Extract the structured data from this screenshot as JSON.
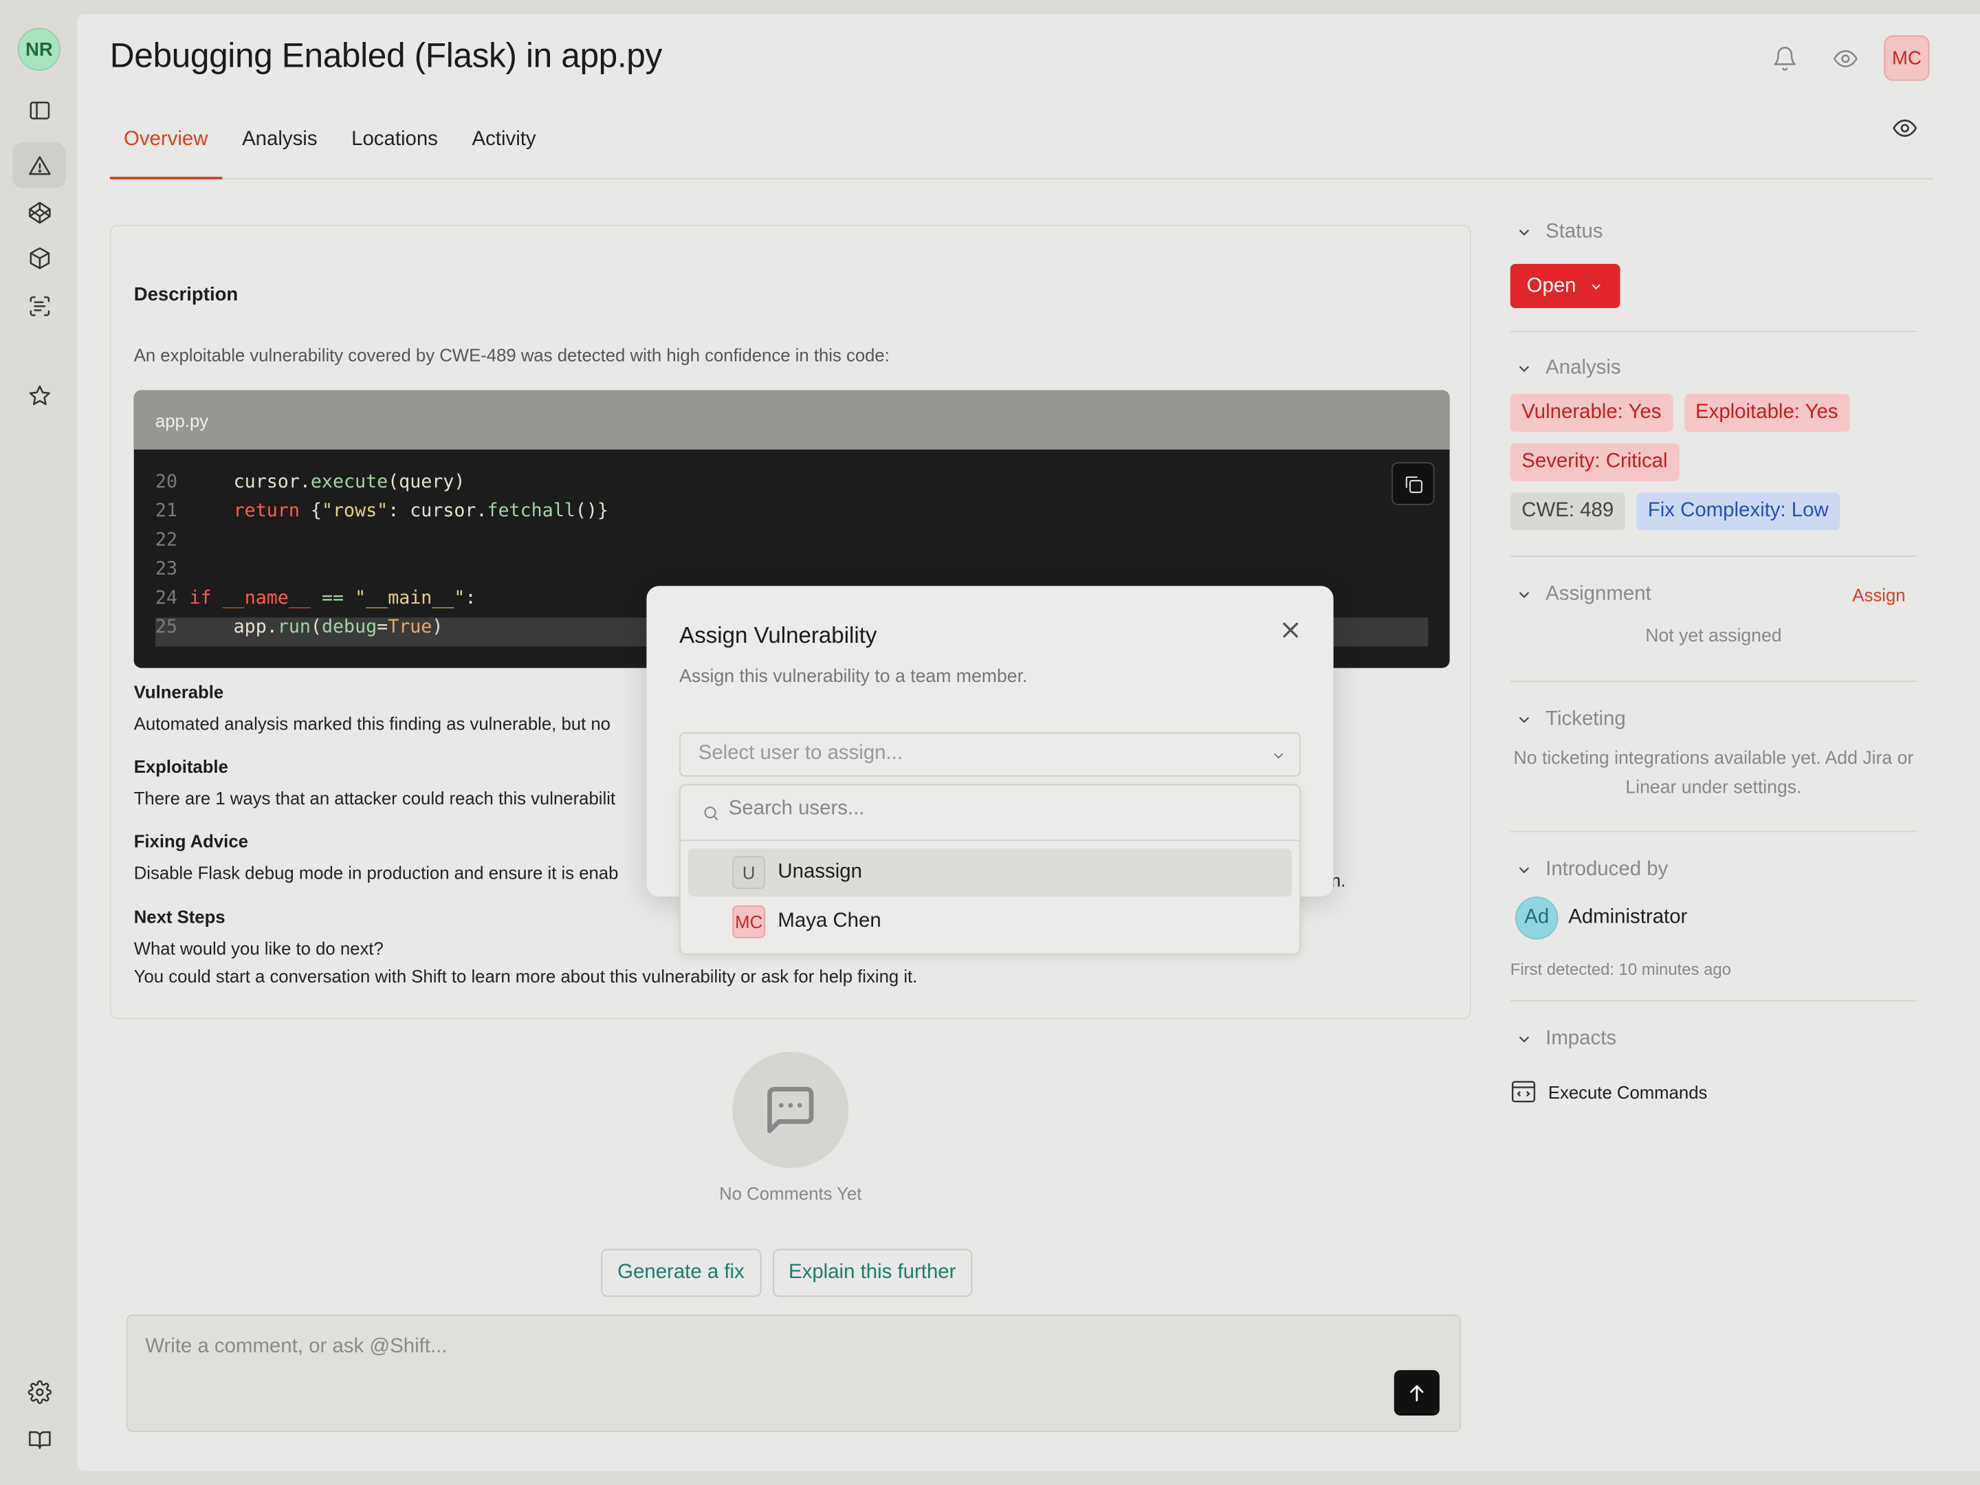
{
  "rail": {
    "user_initials": "NR"
  },
  "header": {
    "title": "Debugging Enabled (Flask) in app.py",
    "user_initials": "MC"
  },
  "tabs": [
    {
      "label": "Overview"
    },
    {
      "label": "Analysis"
    },
    {
      "label": "Locations"
    },
    {
      "label": "Activity"
    }
  ],
  "overview": {
    "description_heading": "Description",
    "description_text": "An exploitable vulnerability covered by CWE-489 was detected with high confidence in this code:",
    "code_filename": "app.py",
    "sections": {
      "vulnerable_title": "Vulnerable",
      "vulnerable_text": "Automated analysis marked this finding as vulnerable, but no",
      "exploitable_title": "Exploitable",
      "exploitable_text": "There are 1 ways that an attacker could reach this vulnerabilit",
      "fixing_title": "Fixing Advice",
      "fixing_text": "Disable Flask debug mode in production and ensure it is enab",
      "fixing_text_tail": "n.",
      "next_title": "Next Steps",
      "next_text_1": "What would you like to do next?",
      "next_text_2": "You could start a conversation with Shift to learn more about this vulnerability or ask for help fixing it."
    }
  },
  "comments": {
    "empty_text": "No Comments Yet",
    "generate_fix": "Generate a fix",
    "explain_further": "Explain this further",
    "placeholder": "Write a comment, or ask @Shift..."
  },
  "sidebar": {
    "status_label": "Status",
    "status_value": "Open",
    "analysis_label": "Analysis",
    "badges": {
      "vulnerable": "Vulnerable: Yes",
      "exploitable": "Exploitable: Yes",
      "severity": "Severity: Critical",
      "cwe": "CWE: 489",
      "fix_complexity": "Fix Complexity: Low"
    },
    "assignment_label": "Assignment",
    "assign_link": "Assign",
    "not_assigned": "Not yet assigned",
    "ticketing_label": "Ticketing",
    "ticketing_text": "No ticketing integrations available yet. Add Jira or Linear under settings.",
    "introduced_label": "Introduced by",
    "introduced_initials": "Ad",
    "introduced_name": "Administrator",
    "first_detected": "First detected: 10 minutes ago",
    "impacts_label": "Impacts",
    "impact_item": "Execute Commands"
  },
  "modal": {
    "title": "Assign Vulnerability",
    "subtitle": "Assign this vulnerability to a team member.",
    "select_placeholder": "Select user to assign...",
    "search_placeholder": "Search users...",
    "options": [
      {
        "initials": "U",
        "label": "Unassign"
      },
      {
        "initials": "MC",
        "label": "Maya Chen"
      }
    ]
  },
  "colors": {
    "accent": "#d9411e",
    "status_red": "#e0262b",
    "link_teal": "#1a7d6e"
  }
}
